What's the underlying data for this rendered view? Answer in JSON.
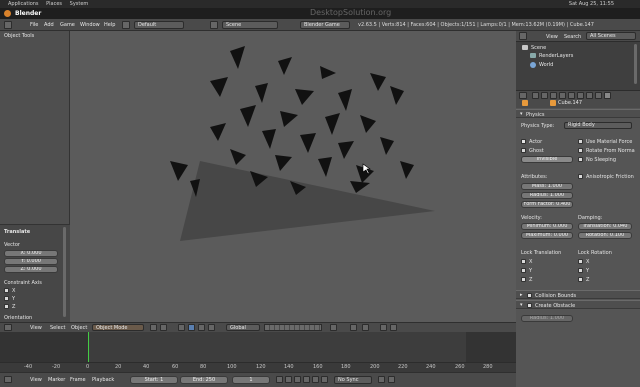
{
  "system_bar": {
    "apps": "Applications",
    "places": "Places",
    "system": "System",
    "time": "Sat Aug 25, 11:55"
  },
  "title": "Blender",
  "watermark": "DesktopSolution.org",
  "info_header": {
    "menus": [
      "File",
      "Add",
      "Game",
      "Window",
      "Help"
    ],
    "screen_layout": "Default",
    "scene": "Scene",
    "engine": "Blender Game",
    "stats": "v2.63.5 | Verts:814 | Faces:604 | Objects:1/151 | Lamps:0/1 | Mem:13.62M (0.19M) | Cube.147"
  },
  "tool_shelf": {
    "header": "Object Tools",
    "translate": {
      "title": "Translate",
      "vector_label": "Vector",
      "x": "X: 0.000",
      "y": "Y: 0.000",
      "z": "Z: 0.000",
      "constraint_axis_label": "Constraint Axis",
      "axes": [
        "X",
        "Y",
        "Z"
      ],
      "orientation_label": "Orientation"
    }
  },
  "viewport_header": {
    "menus": [
      "View",
      "Select",
      "Object"
    ],
    "mode": "Object Mode",
    "orientation": "Global"
  },
  "timeline": {
    "ticks": [
      "-40",
      "-20",
      "0",
      "20",
      "40",
      "60",
      "80",
      "100",
      "120",
      "140",
      "160",
      "180",
      "200",
      "220",
      "240",
      "260",
      "280"
    ],
    "footer": {
      "menus": [
        "View",
        "Marker",
        "Frame",
        "Playback"
      ],
      "start": "Start: 1",
      "end": "End: 250",
      "current": "1",
      "sync": "No Sync"
    }
  },
  "outliner": {
    "header_menus": [
      "View",
      "Search"
    ],
    "filter": "All Scenes",
    "items": [
      "Scene",
      "RenderLayers",
      "World"
    ]
  },
  "properties": {
    "object_name": "Cube.147",
    "physics_header": "Physics",
    "physics_type_label": "Physics Type:",
    "physics_type": "Rigid Body",
    "actor": "Actor",
    "ghost": "Ghost",
    "invisible": "Invisible",
    "use_material_force": "Use Material Force",
    "rotate_from_normal": "Rotate From Norma",
    "no_sleeping": "No Sleeping",
    "attributes_label": "Attributes:",
    "mass": "Mass: 1.000",
    "radius": "Radius: 1.000",
    "form_factor": "Form Factor: 0.400",
    "anisotropic_friction": "Anisotropic Friction",
    "velocity_label": "Velocity:",
    "minimum": "Minimum: 0.000",
    "maximum": "Maximum: 0.000",
    "damping_label": "Damping:",
    "translation": "Translation: 0.040",
    "rotation": "Rotation: 0.100",
    "lock_translation_label": "Lock Translation",
    "lock_rotation_label": "Lock Rotation",
    "lock_axes": [
      "X",
      "Y",
      "Z"
    ],
    "collision_bounds": "Collision Bounds",
    "create_obstacle": "Create Obstacle",
    "obstacle_radius": "Radius: 1.000"
  },
  "colors": {
    "selected_orange": "#e89a3c",
    "frame_line": "#44cc44",
    "timeline_bg": "#3d3d3d"
  }
}
